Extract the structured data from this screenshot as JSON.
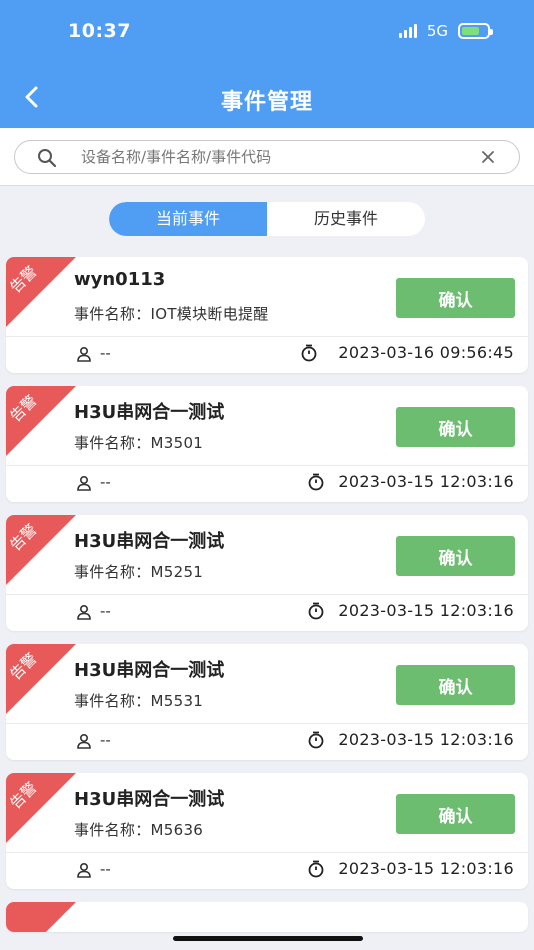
{
  "status_bar": {
    "time": "10:37",
    "network": "5G"
  },
  "header": {
    "title": "事件管理"
  },
  "search": {
    "placeholder": "设备名称/事件名称/事件代码"
  },
  "tabs": [
    {
      "label": "当前事件",
      "active": true
    },
    {
      "label": "历史事件",
      "active": false
    }
  ],
  "cards": [
    {
      "badge": "告警",
      "name": "wyn0113",
      "event_prefix": "事件名称：",
      "event_name": "IOT模块断电提醒",
      "confirm_label": "确认",
      "user": "--",
      "time": "2023-03-16 09:56:45"
    },
    {
      "badge": "告警",
      "name": "H3U串网合一测试",
      "event_prefix": "事件名称：",
      "event_name": "M3501",
      "confirm_label": "确认",
      "user": "--",
      "time": "2023-03-15 12:03:16"
    },
    {
      "badge": "告警",
      "name": "H3U串网合一测试",
      "event_prefix": "事件名称：",
      "event_name": "M5251",
      "confirm_label": "确认",
      "user": "--",
      "time": "2023-03-15 12:03:16"
    },
    {
      "badge": "告警",
      "name": "H3U串网合一测试",
      "event_prefix": "事件名称：",
      "event_name": "M5531",
      "confirm_label": "确认",
      "user": "--",
      "time": "2023-03-15 12:03:16"
    },
    {
      "badge": "告警",
      "name": "H3U串网合一测试",
      "event_prefix": "事件名称：",
      "event_name": "M5636",
      "confirm_label": "确认",
      "user": "--",
      "time": "2023-03-15 12:03:16"
    }
  ],
  "colors": {
    "brand": "#4f9ef3",
    "confirm": "#6cbd70",
    "alarm": "#e85a5a"
  },
  "icons": [
    "back-arrow-icon",
    "search-icon",
    "clear-icon",
    "user-icon",
    "timer-icon",
    "signal-icon",
    "battery-icon"
  ]
}
